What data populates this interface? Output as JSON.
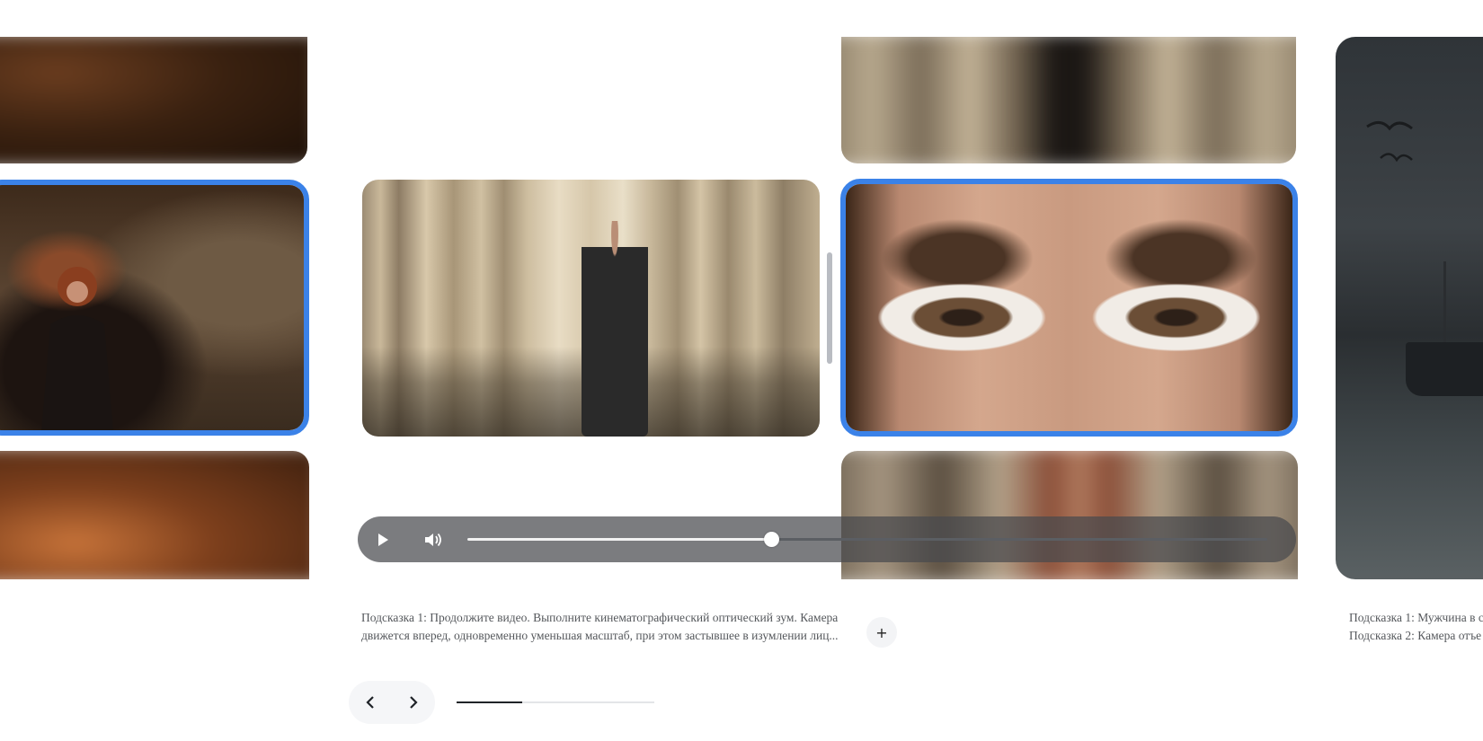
{
  "carousel": {
    "slides": [
      {
        "name": "woman-catacombs",
        "selected": true
      },
      {
        "name": "woman-colonnade",
        "selected": false,
        "playing": true
      },
      {
        "name": "eyes-closeup",
        "selected": true
      },
      {
        "name": "harbour-boat",
        "selected": false
      }
    ],
    "progress_fraction": 0.33
  },
  "player": {
    "play_icon": "play-icon",
    "volume_icon": "volume-icon",
    "progress_fraction": 0.38
  },
  "captions": {
    "main": {
      "line1": "Подсказка 1: Продолжите видео. Выполните кинематографический оптический зум. Камера",
      "line2": "движется вперед, одновременно уменьшая масштаб, при этом застывшее в изумлении лиц..."
    },
    "right": {
      "line1": "Подсказка 1: Мужчина в с",
      "line2": "Подсказка 2: Камера отъе"
    },
    "expand_label": "+"
  },
  "nav": {
    "prev_icon": "chevron-left-icon",
    "next_icon": "chevron-right-icon"
  },
  "colors": {
    "selection": "#3b82e8",
    "controls_bg": "#484a4e"
  }
}
